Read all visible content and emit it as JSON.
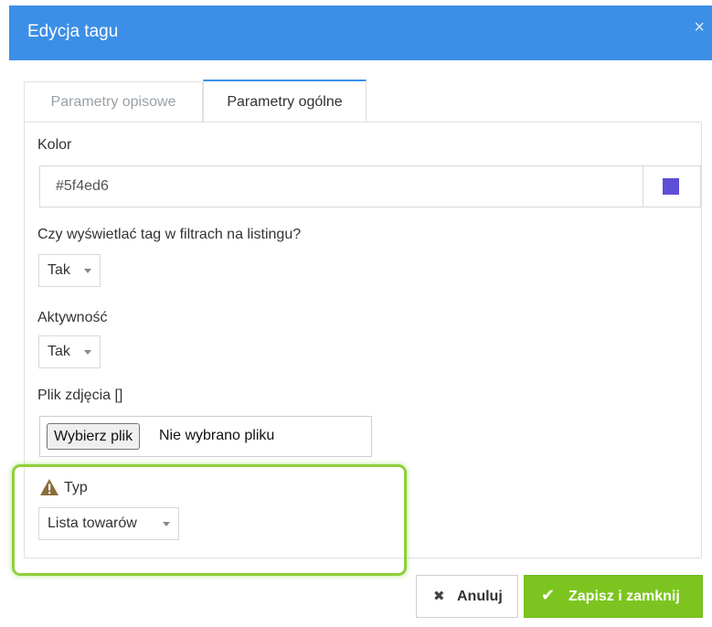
{
  "modal": {
    "title": "Edycja tagu",
    "close_icon": "×"
  },
  "tabs": [
    {
      "label": "Parametry opisowe",
      "active": false
    },
    {
      "label": "Parametry ogólne",
      "active": true
    }
  ],
  "form": {
    "color": {
      "label": "Kolor",
      "value": "#5f4ed6",
      "swatch_color": "#5f4ed6"
    },
    "show_in_filters": {
      "label": "Czy wyświetlać tag w filtrach na listingu?",
      "selected": "Tak"
    },
    "activity": {
      "label": "Aktywność",
      "selected": "Tak"
    },
    "image_file": {
      "label": "Plik zdjęcia []",
      "button_label": "Wybierz plik",
      "status": "Nie wybrano pliku"
    },
    "type": {
      "label": "Typ",
      "warning_icon": "warning-icon",
      "selected": "Lista towarów"
    }
  },
  "footer": {
    "cancel_label": "Anuluj",
    "save_label": "Zapisz i zamknij"
  },
  "colors": {
    "header": "#3c8fe6",
    "save_button": "#7cc520",
    "highlight": "#8fcf3c",
    "warning": "#8a6d3b"
  }
}
